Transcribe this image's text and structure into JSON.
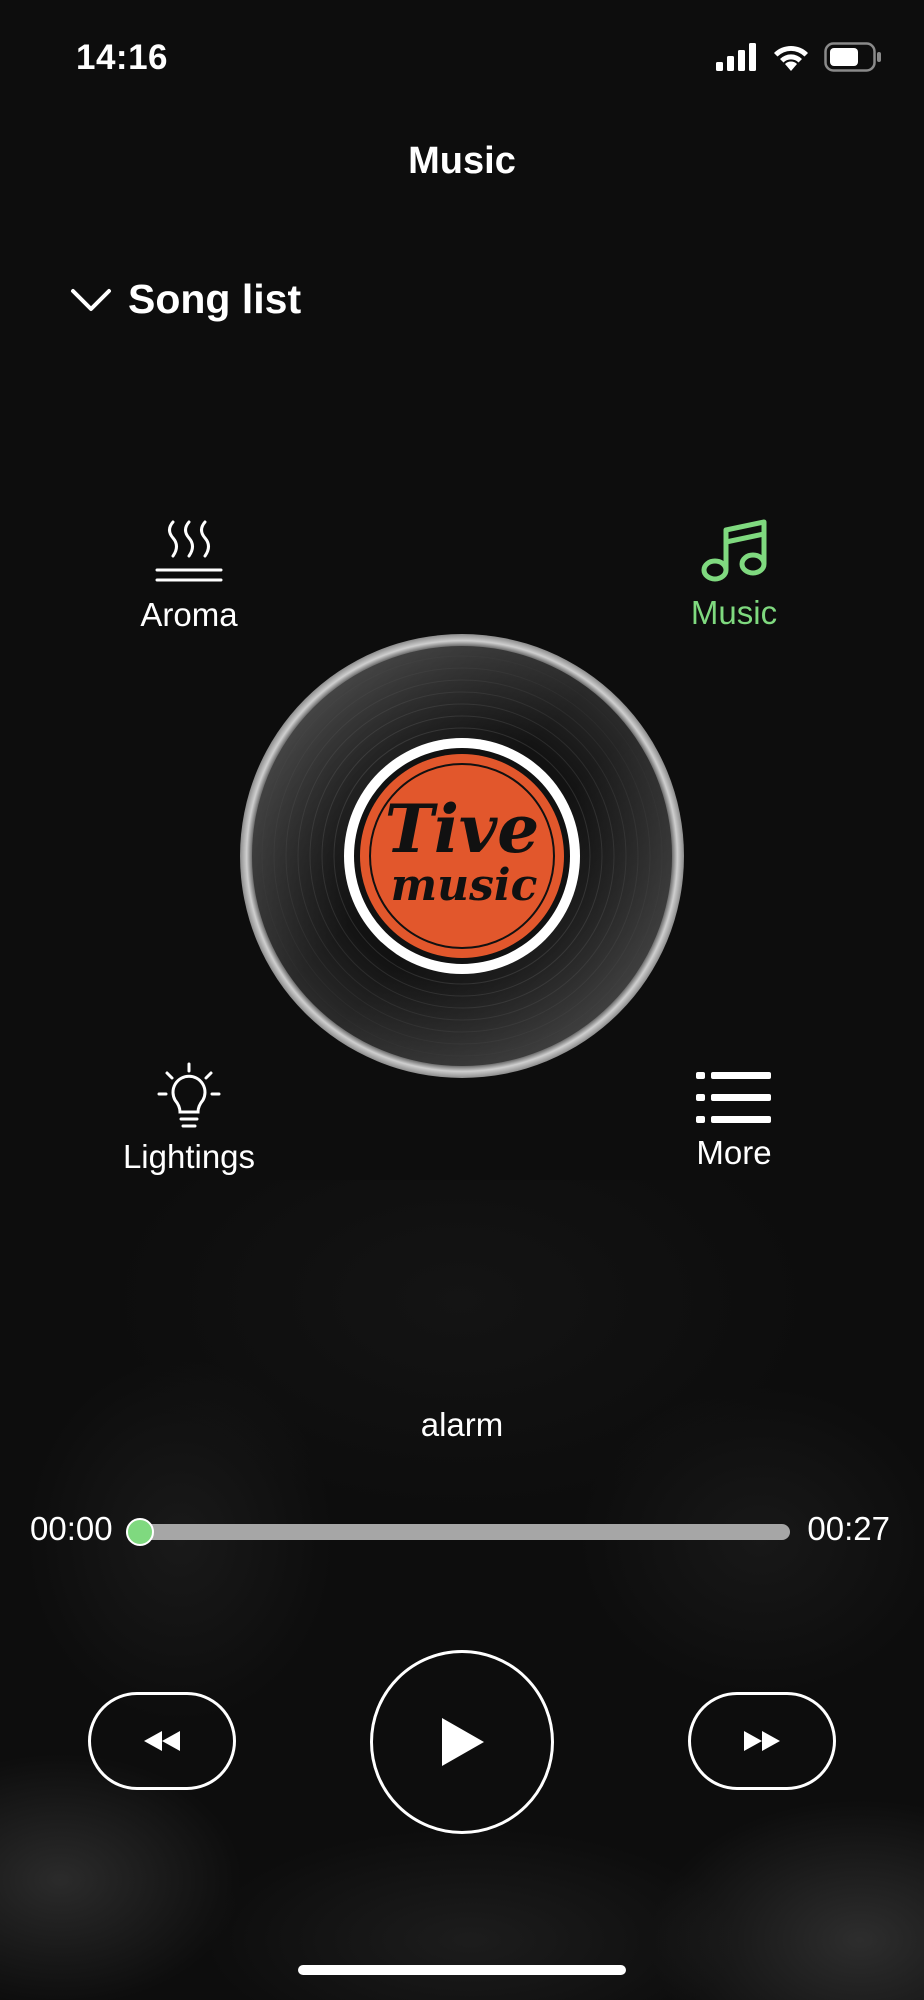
{
  "status_bar": {
    "time": "14:16"
  },
  "header": {
    "title": "Music"
  },
  "song_list": {
    "label": "Song list"
  },
  "modes": {
    "aroma": "Aroma",
    "music": "Music",
    "lightings": "Lightings",
    "more": "More"
  },
  "record": {
    "label_line1": "Tive",
    "label_line2": "music",
    "label_color": "#e2572c"
  },
  "player": {
    "track": "alarm",
    "current_time": "00:00",
    "total_time": "00:27",
    "progress": 0.0
  },
  "colors": {
    "accent": "#7fd97f",
    "background": "#0d0d0d"
  },
  "icons": {
    "song_list": "chevron-down-icon",
    "aroma": "steam-icon",
    "music": "music-note-icon",
    "lightings": "lightbulb-icon",
    "more": "list-icon",
    "prev": "rewind-icon",
    "play": "play-icon",
    "next": "fast-forward-icon"
  }
}
